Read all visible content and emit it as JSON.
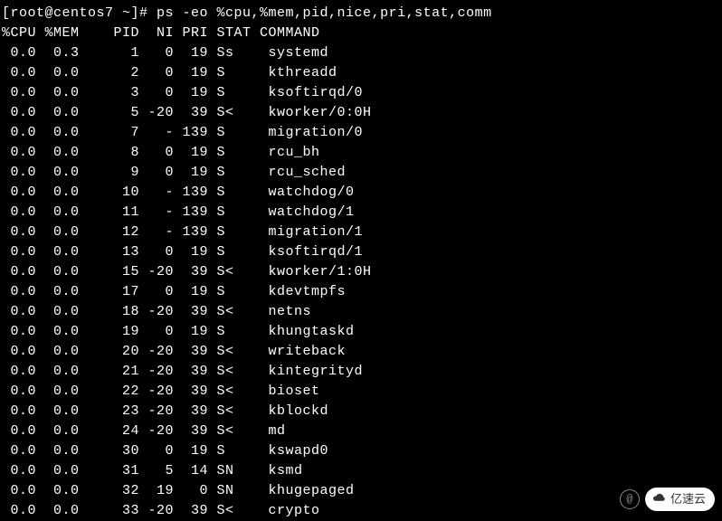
{
  "prompt": "[root@centos7 ~]# ps -eo %cpu,%mem,pid,nice,pri,stat,comm",
  "headers": [
    "%CPU",
    "%MEM",
    "PID",
    "NI",
    "PRI",
    "STAT",
    "COMMAND"
  ],
  "rows": [
    {
      "cpu": "0.0",
      "mem": "0.3",
      "pid": "1",
      "ni": "0",
      "pri": "19",
      "stat": "Ss",
      "comm": "systemd"
    },
    {
      "cpu": "0.0",
      "mem": "0.0",
      "pid": "2",
      "ni": "0",
      "pri": "19",
      "stat": "S",
      "comm": "kthreadd"
    },
    {
      "cpu": "0.0",
      "mem": "0.0",
      "pid": "3",
      "ni": "0",
      "pri": "19",
      "stat": "S",
      "comm": "ksoftirqd/0"
    },
    {
      "cpu": "0.0",
      "mem": "0.0",
      "pid": "5",
      "ni": "-20",
      "pri": "39",
      "stat": "S<",
      "comm": "kworker/0:0H"
    },
    {
      "cpu": "0.0",
      "mem": "0.0",
      "pid": "7",
      "ni": "-",
      "pri": "139",
      "stat": "S",
      "comm": "migration/0"
    },
    {
      "cpu": "0.0",
      "mem": "0.0",
      "pid": "8",
      "ni": "0",
      "pri": "19",
      "stat": "S",
      "comm": "rcu_bh"
    },
    {
      "cpu": "0.0",
      "mem": "0.0",
      "pid": "9",
      "ni": "0",
      "pri": "19",
      "stat": "S",
      "comm": "rcu_sched"
    },
    {
      "cpu": "0.0",
      "mem": "0.0",
      "pid": "10",
      "ni": "-",
      "pri": "139",
      "stat": "S",
      "comm": "watchdog/0"
    },
    {
      "cpu": "0.0",
      "mem": "0.0",
      "pid": "11",
      "ni": "-",
      "pri": "139",
      "stat": "S",
      "comm": "watchdog/1"
    },
    {
      "cpu": "0.0",
      "mem": "0.0",
      "pid": "12",
      "ni": "-",
      "pri": "139",
      "stat": "S",
      "comm": "migration/1"
    },
    {
      "cpu": "0.0",
      "mem": "0.0",
      "pid": "13",
      "ni": "0",
      "pri": "19",
      "stat": "S",
      "comm": "ksoftirqd/1"
    },
    {
      "cpu": "0.0",
      "mem": "0.0",
      "pid": "15",
      "ni": "-20",
      "pri": "39",
      "stat": "S<",
      "comm": "kworker/1:0H"
    },
    {
      "cpu": "0.0",
      "mem": "0.0",
      "pid": "17",
      "ni": "0",
      "pri": "19",
      "stat": "S",
      "comm": "kdevtmpfs"
    },
    {
      "cpu": "0.0",
      "mem": "0.0",
      "pid": "18",
      "ni": "-20",
      "pri": "39",
      "stat": "S<",
      "comm": "netns"
    },
    {
      "cpu": "0.0",
      "mem": "0.0",
      "pid": "19",
      "ni": "0",
      "pri": "19",
      "stat": "S",
      "comm": "khungtaskd"
    },
    {
      "cpu": "0.0",
      "mem": "0.0",
      "pid": "20",
      "ni": "-20",
      "pri": "39",
      "stat": "S<",
      "comm": "writeback"
    },
    {
      "cpu": "0.0",
      "mem": "0.0",
      "pid": "21",
      "ni": "-20",
      "pri": "39",
      "stat": "S<",
      "comm": "kintegrityd"
    },
    {
      "cpu": "0.0",
      "mem": "0.0",
      "pid": "22",
      "ni": "-20",
      "pri": "39",
      "stat": "S<",
      "comm": "bioset"
    },
    {
      "cpu": "0.0",
      "mem": "0.0",
      "pid": "23",
      "ni": "-20",
      "pri": "39",
      "stat": "S<",
      "comm": "kblockd"
    },
    {
      "cpu": "0.0",
      "mem": "0.0",
      "pid": "24",
      "ni": "-20",
      "pri": "39",
      "stat": "S<",
      "comm": "md"
    },
    {
      "cpu": "0.0",
      "mem": "0.0",
      "pid": "30",
      "ni": "0",
      "pri": "19",
      "stat": "S",
      "comm": "kswapd0"
    },
    {
      "cpu": "0.0",
      "mem": "0.0",
      "pid": "31",
      "ni": "5",
      "pri": "14",
      "stat": "SN",
      "comm": "ksmd"
    },
    {
      "cpu": "0.0",
      "mem": "0.0",
      "pid": "32",
      "ni": "19",
      "pri": "0",
      "stat": "SN",
      "comm": "khugepaged"
    },
    {
      "cpu": "0.0",
      "mem": "0.0",
      "pid": "33",
      "ni": "-20",
      "pri": "39",
      "stat": "S<",
      "comm": "crypto"
    }
  ],
  "watermark": {
    "at_symbol": "@",
    "text": "亿速云"
  }
}
